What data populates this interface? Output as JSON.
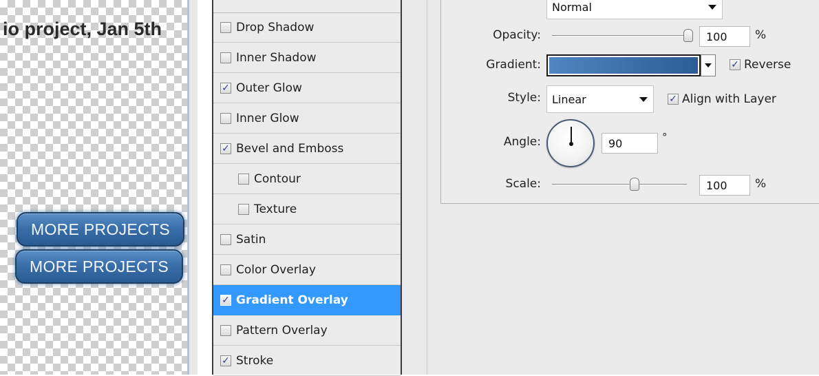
{
  "canvas": {
    "title": "io project, Jan 5th",
    "buttons": [
      "MORE PROJECTS",
      "MORE PROJECTS"
    ]
  },
  "styles_list": {
    "items": [
      {
        "label": "Drop Shadow",
        "checked": false,
        "indent": false,
        "selected": false
      },
      {
        "label": "Inner Shadow",
        "checked": false,
        "indent": false,
        "selected": false
      },
      {
        "label": "Outer Glow",
        "checked": true,
        "indent": false,
        "selected": false
      },
      {
        "label": "Inner Glow",
        "checked": false,
        "indent": false,
        "selected": false
      },
      {
        "label": "Bevel and Emboss",
        "checked": true,
        "indent": false,
        "selected": false
      },
      {
        "label": "Contour",
        "checked": false,
        "indent": true,
        "selected": false
      },
      {
        "label": "Texture",
        "checked": false,
        "indent": true,
        "selected": false
      },
      {
        "label": "Satin",
        "checked": false,
        "indent": false,
        "selected": false
      },
      {
        "label": "Color Overlay",
        "checked": false,
        "indent": false,
        "selected": false
      },
      {
        "label": "Gradient Overlay",
        "checked": true,
        "indent": false,
        "selected": true
      },
      {
        "label": "Pattern Overlay",
        "checked": false,
        "indent": false,
        "selected": false
      },
      {
        "label": "Stroke",
        "checked": true,
        "indent": false,
        "selected": false
      }
    ],
    "selected_color": "#3399ff"
  },
  "gradient_overlay": {
    "blend_mode_value": "Normal",
    "opacity_label": "Opacity:",
    "opacity_value": "100",
    "opacity_percent": 100,
    "opacity_unit": "%",
    "gradient_label": "Gradient:",
    "gradient_colors": [
      "#4f86c0",
      "#2d5d93"
    ],
    "reverse_label": "Reverse",
    "reverse_checked": true,
    "style_label": "Style:",
    "style_value": "Linear",
    "align_label": "Align with Layer",
    "align_checked": true,
    "angle_label": "Angle:",
    "angle_value": "90",
    "angle_degrees": 90,
    "angle_unit": "°",
    "scale_label": "Scale:",
    "scale_value": "100",
    "scale_percent": 100,
    "scale_unit": "%"
  },
  "icons": {
    "checkbox_checked": "checkmark-icon",
    "dropdown_caret": "chevron-down-icon",
    "angle_dial": "angle-dial-icon"
  }
}
